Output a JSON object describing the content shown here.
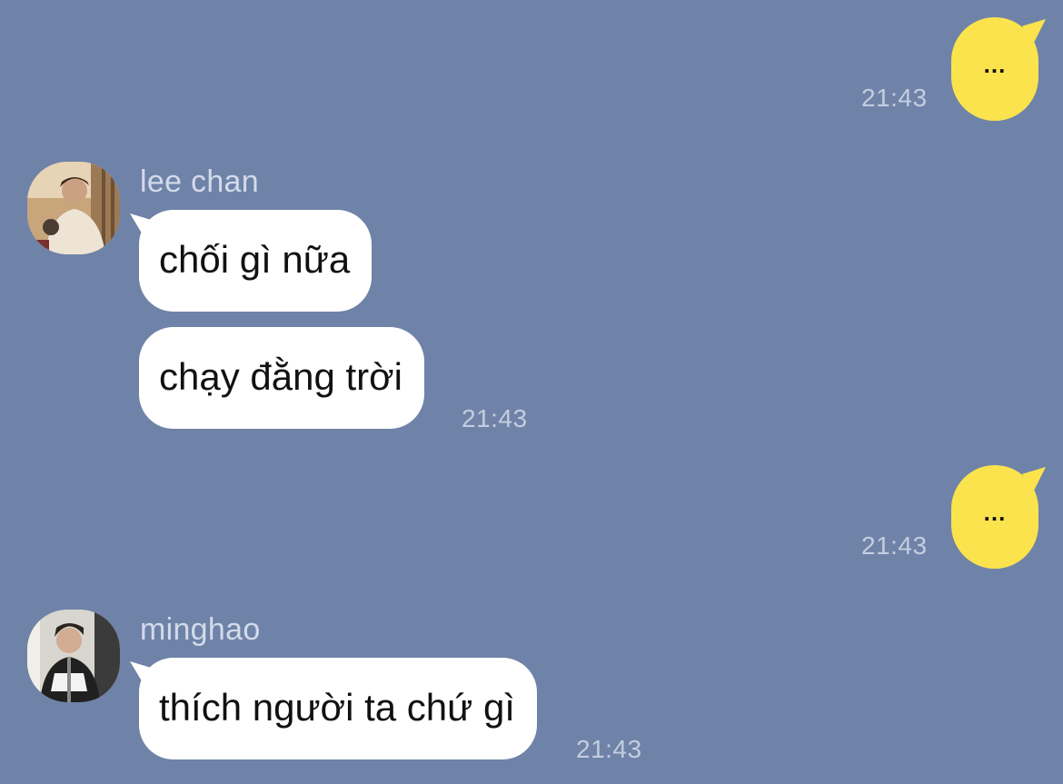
{
  "colors": {
    "background": "#6f83a8",
    "outgoing_bubble": "#fbe34d",
    "incoming_bubble": "#ffffff",
    "timestamp": "#c4cde0",
    "sender_name": "#d3daea"
  },
  "messages": [
    {
      "direction": "outgoing",
      "text": "...",
      "time": "21:43"
    },
    {
      "direction": "incoming",
      "sender": "lee chan",
      "avatar": "avatar-photo",
      "bubbles": [
        "chối gì nữa",
        "chạy đằng trời"
      ],
      "time": "21:43"
    },
    {
      "direction": "outgoing",
      "text": "...",
      "time": "21:43"
    },
    {
      "direction": "incoming",
      "sender": "minghao",
      "avatar": "avatar-photo",
      "bubbles": [
        "thích người ta chứ gì"
      ],
      "time": "21:43"
    }
  ]
}
